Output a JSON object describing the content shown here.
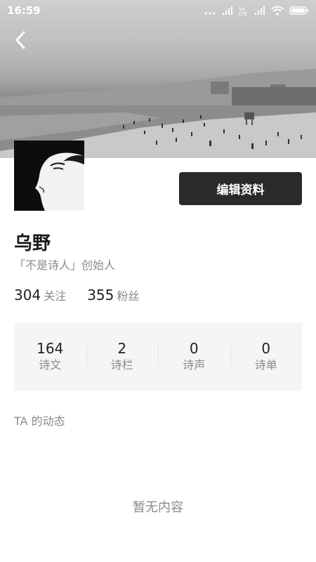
{
  "status_bar": {
    "time": "16:59",
    "network_label": "Vo LTE",
    "icons": [
      "signal-dots-icon",
      "signal-icon",
      "volte-icon",
      "signal-icon",
      "wifi-icon",
      "battery-icon"
    ]
  },
  "header": {
    "back_icon": "chevron-left-icon"
  },
  "profile": {
    "name": "乌野",
    "bio": "「不是诗人」创始人",
    "edit_button": "编辑资料",
    "following_count": "304",
    "following_label": "关注",
    "followers_count": "355",
    "followers_label": "粉丝"
  },
  "stats": [
    {
      "value": "164",
      "label": "诗文"
    },
    {
      "value": "2",
      "label": "诗栏"
    },
    {
      "value": "0",
      "label": "诗声"
    },
    {
      "value": "0",
      "label": "诗单"
    }
  ],
  "activity": {
    "title": "TA 的动态",
    "empty_text": "暂无内容"
  }
}
